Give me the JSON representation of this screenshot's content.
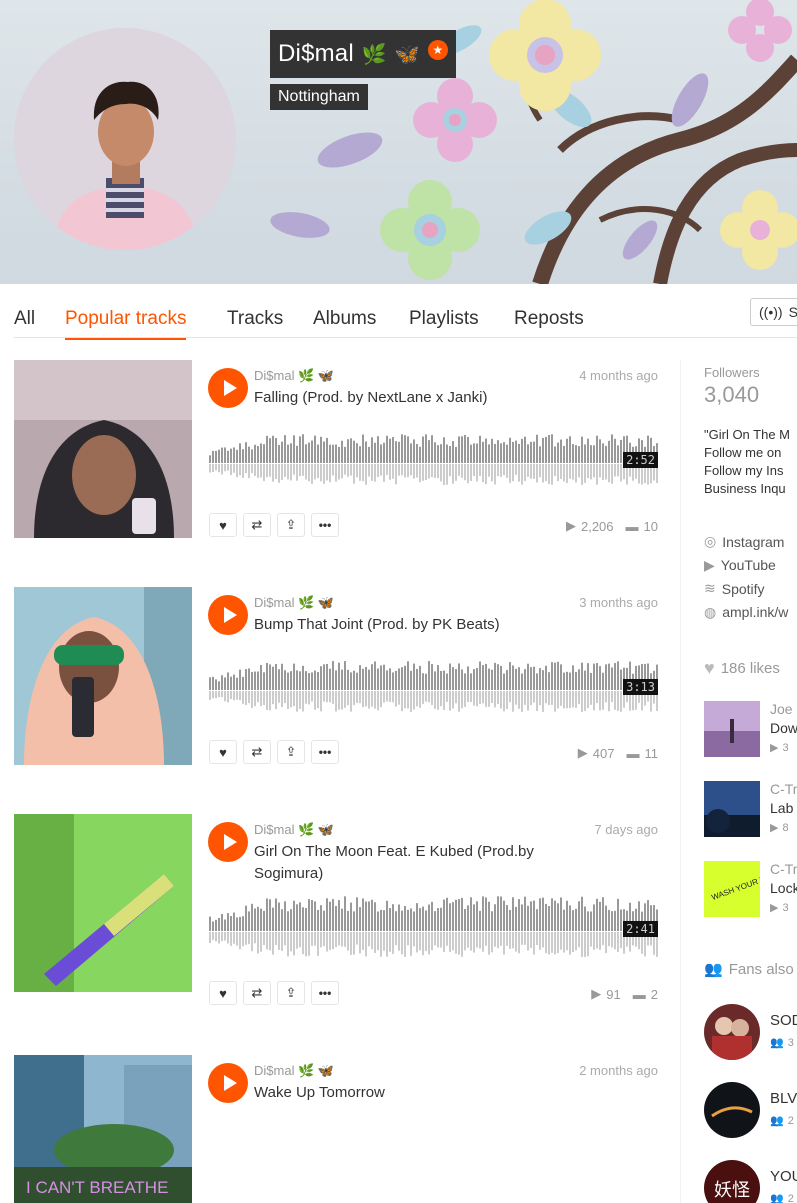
{
  "profile": {
    "name": "Di$mal",
    "emojis": [
      "🌿",
      "🦋"
    ],
    "location": "Nottingham",
    "accent": "#ff5500"
  },
  "tabs": [
    {
      "label": "All"
    },
    {
      "label": "Popular tracks",
      "active": true
    },
    {
      "label": "Tracks"
    },
    {
      "label": "Albums"
    },
    {
      "label": "Playlists"
    },
    {
      "label": "Reposts"
    }
  ],
  "station_label": "St",
  "tracks": [
    {
      "user": "Di$mal 🌿 🦋",
      "title": "Falling (Prod. by NextLane x Janki)",
      "posted": "4 months ago",
      "duration": "2:52",
      "plays": "2,206",
      "comments": "10",
      "progress": 0
    },
    {
      "user": "Di$mal 🌿 🦋",
      "title": "Bump That Joint (Prod. by PK Beats)",
      "posted": "3 months ago",
      "duration": "3:13",
      "plays": "407",
      "comments": "11",
      "progress": 0
    },
    {
      "user": "Di$mal 🌿 🦋",
      "title": "Girl On The Moon Feat. E Kubed (Prod.by Sogimura)",
      "posted": "7 days ago",
      "duration": "2:41",
      "plays": "91",
      "comments": "2",
      "progress": 0
    },
    {
      "user": "Di$mal 🌿 🦋",
      "title": "Wake Up Tomorrow",
      "posted": "2 months ago"
    }
  ],
  "artwork_text": {
    "t4": "I CAN'T BREATHE"
  },
  "sidebar": {
    "followers_label": "Followers",
    "followers_count": "3,040",
    "bio": [
      "\"Girl On The M",
      "Follow me on",
      "Follow my Ins",
      "Business Inqu"
    ],
    "links": [
      {
        "label": "Instagram",
        "icon": "instagram-icon"
      },
      {
        "label": "YouTube",
        "icon": "youtube-icon"
      },
      {
        "label": "Spotify",
        "icon": "spotify-icon"
      },
      {
        "label": "ampl.ink/w",
        "icon": "globe-icon"
      }
    ],
    "likes_label": "186 likes",
    "likes": [
      {
        "user": "Joe",
        "title": "Dow",
        "plays": "3"
      },
      {
        "user": "C-Tr",
        "title": "Lab",
        "plays": "8"
      },
      {
        "user": "C-Tr",
        "title": "Lock",
        "plays": "3"
      }
    ],
    "likes_art_text": "WASH YOUR HANDS",
    "fans_label": "Fans also",
    "fans": [
      {
        "name": "SOD",
        "count": "3"
      },
      {
        "name": "BLV",
        "count": "2"
      },
      {
        "name": "YOU",
        "count": "2"
      }
    ],
    "fan_art_text": "妖怪"
  }
}
